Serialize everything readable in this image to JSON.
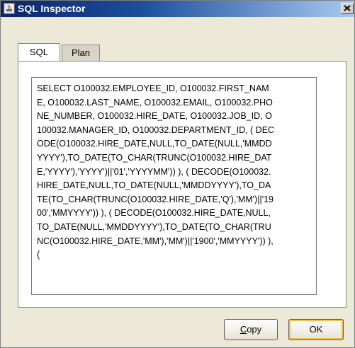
{
  "window": {
    "title": "SQL Inspector",
    "close_glyph": "✕"
  },
  "tabs": [
    {
      "label": "SQL",
      "active": true
    },
    {
      "label": "Plan",
      "active": false
    }
  ],
  "sql": {
    "text": "SELECT O100032.EMPLOYEE_ID, O100032.FIRST_NAME, O100032.LAST_NAME, O100032.EMAIL, O100032.PHONE_NUMBER, O100032.HIRE_DATE, O100032.JOB_ID, O100032.MANAGER_ID, O100032.DEPARTMENT_ID, ( DECODE(O100032.HIRE_DATE,NULL,TO_DATE(NULL,'MMDDYYYY'),TO_DATE(TO_CHAR(TRUNC(O100032.HIRE_DATE,'YYYY'),'YYYY')||'01','YYYYMM')) ), ( DECODE(O100032.HIRE_DATE,NULL,TO_DATE(NULL,'MMDDYYYY'),TO_DATE(TO_CHAR(TRUNC(O100032.HIRE_DATE,'Q'),'MM')||'1900','MMYYYY')) ), ( DECODE(O100032.HIRE_DATE,NULL,TO_DATE(NULL,'MMDDYYYY'),TO_DATE(TO_CHAR(TRUNC(O100032.HIRE_DATE,'MM'),'MM')||'1900','MMYYYY')) ), ("
  },
  "buttons": {
    "copy_mnemonic": "C",
    "copy_rest": "opy",
    "ok_label": "OK"
  }
}
